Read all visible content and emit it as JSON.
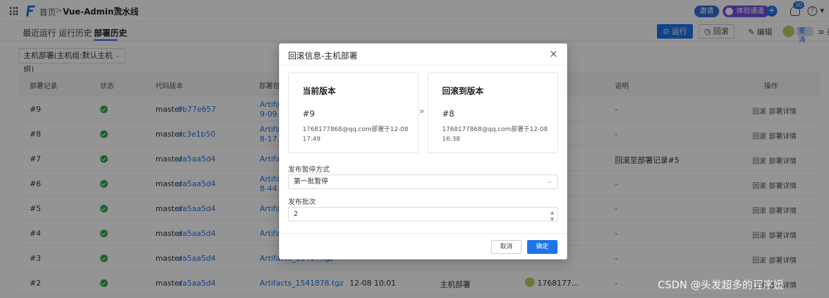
{
  "topbar": {
    "home": "首页",
    "separator": ">",
    "pipeline_name": "Vue-Admin流水线",
    "invite": "邀请",
    "experience": "体验通道",
    "notification_count": "30",
    "help": "?"
  },
  "tabs": [
    {
      "label": "最近运行"
    },
    {
      "label": "运行历史"
    },
    {
      "label": "部署历史"
    }
  ],
  "actions": {
    "run": "运行",
    "rollback": "回滚",
    "edit": "编辑",
    "user": "麦涛",
    "more": "≡ 菜"
  },
  "filter": {
    "value": "主机部署(主机组:默认主机组)"
  },
  "table": {
    "headers": [
      "部署记录",
      "状态",
      "代码版本",
      "部署包",
      "说明",
      "操作"
    ],
    "rows": [
      {
        "id": "#9",
        "branch": "master",
        "commit": "0b77e657",
        "artifact": "Artifact",
        "artifact2": "9-09.tgz",
        "note": "-"
      },
      {
        "id": "#8",
        "branch": "master",
        "commit": "dc3e1b50",
        "artifact": "Artifact",
        "artifact2": "8-17.tgz",
        "note": "-"
      },
      {
        "id": "#7",
        "branch": "master",
        "commit": "da5aa5d4",
        "artifact": "Artifact",
        "artifact2": "",
        "note": "回滚至部署记录#5"
      },
      {
        "id": "#6",
        "branch": "master",
        "commit": "da5aa5d4",
        "artifact": "Artifact",
        "artifact2": "8-44.tgz",
        "note": "-"
      },
      {
        "id": "#5",
        "branch": "master",
        "commit": "da5aa5d4",
        "artifact": "Artifact",
        "artifact2": "",
        "note": "-"
      },
      {
        "id": "#4",
        "branch": "master",
        "commit": "da5aa5d4",
        "artifact": "Artifact",
        "artifact2": "",
        "note": "-"
      },
      {
        "id": "#3",
        "branch": "master",
        "commit": "da5aa5d4",
        "artifact": "Artifacts_1541...tgz",
        "artifact2": "",
        "note": "-"
      },
      {
        "id": "#2",
        "branch": "master",
        "commit": "da5aa5d4",
        "artifact": "Artifacts_1541878.tgz",
        "artifact2": "",
        "note": "-"
      }
    ],
    "row2_time": "12-08 10:01",
    "row2_env": "主机部署",
    "row2_user": "1768177...",
    "op_rollback": "回滚",
    "op_detail": "部署详情"
  },
  "modal": {
    "title": "回滚信息-主机部署",
    "close": "×",
    "current": {
      "heading": "当前版本",
      "number": "#9",
      "desc": "1768177868@qq.com部署于12-08 17:49"
    },
    "target": {
      "heading": "回滚到版本",
      "number": "#8",
      "desc": "1768177868@qq.com部署于12-08 16:38"
    },
    "arrow": "»",
    "pause_label": "发布暂停方式",
    "pause_value": "第一批暂停",
    "batch_label": "发布批次",
    "batch_value": "2",
    "cancel": "取消",
    "confirm": "确定"
  },
  "watermark": "CSDN @头发超多的程序媛"
}
